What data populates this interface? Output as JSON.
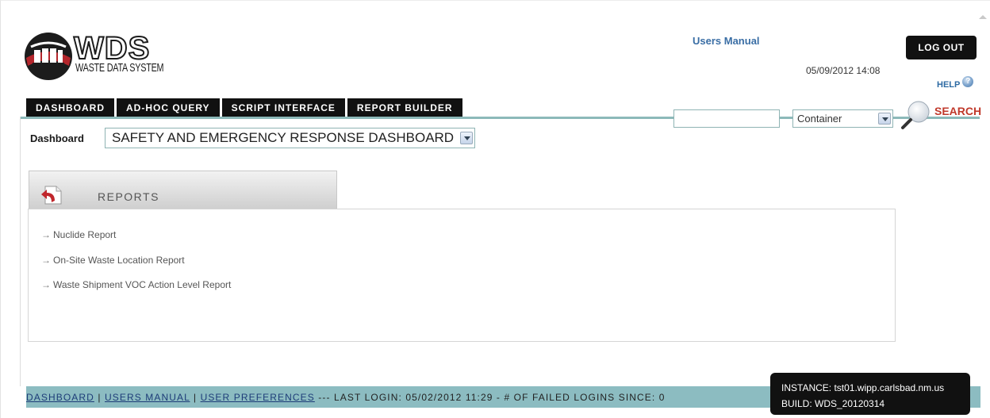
{
  "app": {
    "logo_title": "WDS",
    "logo_subtitle": "WASTE DATA SYSTEM"
  },
  "header": {
    "users_manual": "Users Manual",
    "datetime": "05/09/2012 14:08",
    "logout_label": "LOG OUT",
    "help_label": "HELP"
  },
  "nav": {
    "tabs": [
      {
        "label": "DASHBOARD"
      },
      {
        "label": "AD-HOC QUERY"
      },
      {
        "label": "SCRIPT INTERFACE"
      },
      {
        "label": "REPORT BUILDER"
      }
    ]
  },
  "search": {
    "value": "",
    "type_selected": "Container",
    "label": "SEARCH"
  },
  "dashboard": {
    "label": "Dashboard",
    "selected": "SAFETY AND EMERGENCY RESPONSE DASHBOARD"
  },
  "reports": {
    "title": "REPORTS",
    "items": [
      {
        "label": "Nuclide Report"
      },
      {
        "label": "On-Site Waste Location Report"
      },
      {
        "label": "Waste Shipment VOC Action Level Report"
      }
    ]
  },
  "footer": {
    "links": [
      "DASHBOARD",
      "USERS MANUAL",
      "USER PREFERENCES"
    ],
    "separator": " | ",
    "status": " --- LAST LOGIN: 05/02/2012 11:29 - # OF FAILED LOGINS SINCE: 0"
  },
  "instance": {
    "instance_line": "INSTANCE: tst01.wipp.carlsbad.nm.us",
    "build_line": "BUILD: WDS_20120314"
  },
  "colors": {
    "accent_teal": "#8cbcc1",
    "link_blue": "#3a6ea5",
    "search_red": "#c0392b"
  }
}
